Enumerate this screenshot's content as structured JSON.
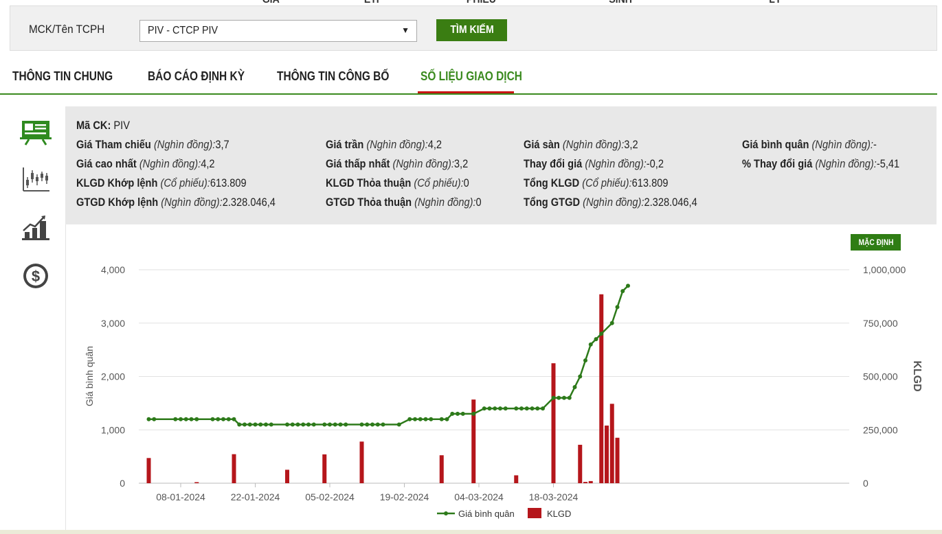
{
  "top_nav_partial": [
    "GIÁ",
    "ETF",
    "PHIẾU",
    "SINH",
    "LÝ"
  ],
  "search": {
    "label": "MCK/Tên TCPH",
    "selected": "PIV - CTCP PIV",
    "button_label": "TÌM KIẾM"
  },
  "tabs": [
    {
      "label": "THÔNG TIN CHUNG",
      "active": false
    },
    {
      "label": "BÁO CÁO ĐỊNH KỲ",
      "active": false
    },
    {
      "label": "THÔNG TIN CÔNG BỐ",
      "active": false
    },
    {
      "label": "SỐ LIỆU GIAO DỊCH",
      "active": true
    }
  ],
  "sidebar_icons": [
    "presentation-board-icon",
    "candlestick-chart-icon",
    "bar-growth-chart-icon",
    "dollar-coin-icon"
  ],
  "info": {
    "code_label": "Mã CK:",
    "code_value": "PIV",
    "unit_dong": "(Nghìn đồng):",
    "unit_shares": "(Cổ phiếu):",
    "ref_label": "Giá Tham chiếu",
    "ref_value": "3,7",
    "ceil_label": "Giá trần",
    "ceil_value": "4,2",
    "floor_label": "Giá sàn",
    "floor_value": "3,2",
    "avg_label": "Giá bình quân",
    "avg_value": "-",
    "high_label": "Giá cao nhất",
    "high_value": "4,2",
    "low_label": "Giá thấp nhất",
    "low_value": "3,2",
    "change_label": "Thay đổi giá",
    "change_value": "-0,2",
    "pct_label": "% Thay đổi giá",
    "pct_value": "-5,41",
    "klgd_match_label": "KLGD Khớp lệnh",
    "klgd_match_value": "613.809",
    "klgd_deal_label": "KLGD Thỏa thuận",
    "klgd_deal_value": "0",
    "klgd_total_label": "Tổng KLGD",
    "klgd_total_value": "613.809",
    "gtgd_match_label": "GTGD Khớp lệnh",
    "gtgd_match_value": "2.328.046,4",
    "gtgd_deal_label": "GTGD Thỏa thuận",
    "gtgd_deal_value": "0",
    "gtgd_total_label": "Tổng GTGD",
    "gtgd_total_value": "2.328.046,4"
  },
  "default_button": "MẶC ĐỊNH",
  "colors": {
    "accent_green": "#3a7d12",
    "tab_underline": "#c81414",
    "bar_red": "#b5161b",
    "line_green": "#2d7a1a"
  },
  "chart_data": {
    "type": "bar+line",
    "x_tick_labels": [
      "08-01-2024",
      "22-01-2024",
      "05-02-2024",
      "19-02-2024",
      "04-03-2024",
      "18-03-2024"
    ],
    "x_tick_days": [
      7,
      21,
      35,
      49,
      63,
      77
    ],
    "y_left_label": "Giá bình quân",
    "y_left_range": [
      0,
      4000
    ],
    "y_left_ticks": [
      "0",
      "1,000",
      "2,000",
      "3,000",
      "4,000"
    ],
    "y_right_label": "KLGD",
    "y_right_range": [
      0,
      1000000
    ],
    "y_right_ticks": [
      "0",
      "250,000",
      "500,000",
      "750,000",
      "1,000,000"
    ],
    "grid": true,
    "legend_position": "bottom",
    "series": [
      {
        "name": "Giá bình quân",
        "kind": "line",
        "x": [
          1,
          2,
          6,
          7,
          8,
          9,
          10,
          13,
          14,
          15,
          16,
          17,
          18,
          19,
          20,
          21,
          22,
          23,
          24,
          27,
          28,
          29,
          30,
          31,
          32,
          34,
          35,
          36,
          37,
          38,
          41,
          42,
          43,
          44,
          45,
          48,
          50,
          51,
          52,
          53,
          54,
          56,
          57,
          58,
          59,
          60,
          62,
          64,
          65,
          66,
          67,
          68,
          70,
          71,
          72,
          73,
          74,
          75,
          77,
          78,
          79,
          80,
          81,
          82,
          83,
          84,
          85,
          86,
          88,
          89,
          90,
          91
        ],
        "values": [
          1200,
          1200,
          1200,
          1200,
          1200,
          1200,
          1200,
          1200,
          1200,
          1200,
          1200,
          1200,
          1100,
          1100,
          1100,
          1100,
          1100,
          1100,
          1100,
          1100,
          1100,
          1100,
          1100,
          1100,
          1100,
          1100,
          1100,
          1100,
          1100,
          1100,
          1100,
          1100,
          1100,
          1100,
          1100,
          1100,
          1200,
          1200,
          1200,
          1200,
          1200,
          1200,
          1200,
          1300,
          1300,
          1300,
          1300,
          1400,
          1400,
          1400,
          1400,
          1400,
          1400,
          1400,
          1400,
          1400,
          1400,
          1400,
          1600,
          1600,
          1600,
          1600,
          1800,
          2000,
          2300,
          2600,
          2700,
          2800,
          3000,
          3300,
          3600,
          3700
        ]
      },
      {
        "name": "KLGD",
        "kind": "bar",
        "x": [
          1,
          10,
          17,
          27,
          34,
          41,
          56,
          62,
          70,
          77,
          82,
          83,
          84,
          86,
          87,
          88,
          89
        ],
        "values": [
          118000,
          5000,
          136000,
          63000,
          135000,
          195000,
          131000,
          392000,
          37000,
          562000,
          180000,
          6000,
          10000,
          885000,
          270000,
          372000,
          213000
        ]
      }
    ]
  }
}
